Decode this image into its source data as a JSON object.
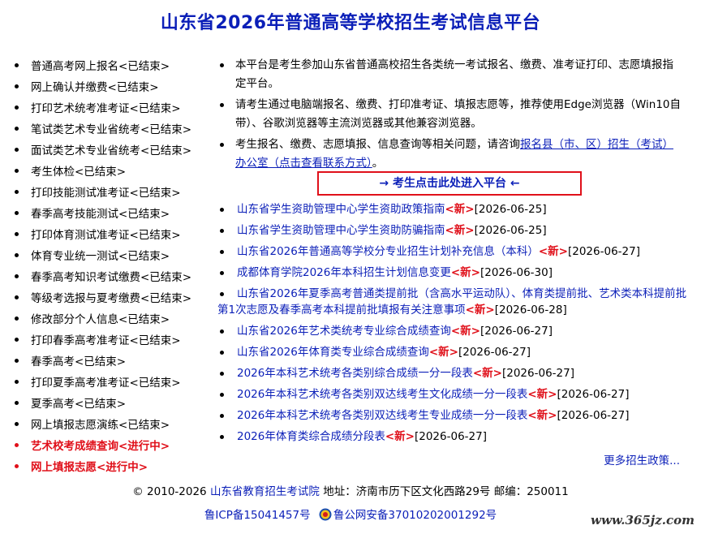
{
  "title": "山东省2026年普通高等学校招生考试信息平台",
  "left_menu": [
    {
      "label": "普通高考网上报名<已结束>",
      "active": false
    },
    {
      "label": "网上确认并缴费<已结束>",
      "active": false
    },
    {
      "label": "打印艺术统考准考证<已结束>",
      "active": false
    },
    {
      "label": "笔试类艺术专业省统考<已结束>",
      "active": false
    },
    {
      "label": "面试类艺术专业省统考<已结束>",
      "active": false
    },
    {
      "label": "考生体检<已结束>",
      "active": false
    },
    {
      "label": "打印技能测试准考证<已结束>",
      "active": false
    },
    {
      "label": "春季高考技能测试<已结束>",
      "active": false
    },
    {
      "label": "打印体育测试准考证<已结束>",
      "active": false
    },
    {
      "label": "体育专业统一测试<已结束>",
      "active": false
    },
    {
      "label": "春季高考知识考试缴费<已结束>",
      "active": false
    },
    {
      "label": "等级考选报与夏考缴费<已结束>",
      "active": false
    },
    {
      "label": "修改部分个人信息<已结束>",
      "active": false
    },
    {
      "label": "打印春季高考准考证<已结束>",
      "active": false
    },
    {
      "label": "春季高考<已结束>",
      "active": false
    },
    {
      "label": "打印夏季高考准考证<已结束>",
      "active": false
    },
    {
      "label": "夏季高考<已结束>",
      "active": false
    },
    {
      "label": "网上填报志愿演练<已结束>",
      "active": false
    },
    {
      "label": "艺术校考成绩查询<进行中>",
      "active": true
    },
    {
      "label": "网上填报志愿<进行中>",
      "active": true
    }
  ],
  "notes": {
    "n1": "本平台是考生参加山东省普通高校招生各类统一考试报名、缴费、准考证打印、志愿填报指定平台。",
    "n2": "请考生通过电脑端报名、缴费、打印准考证、填报志愿等，推荐使用Edge浏览器（Win10自带）、谷歌浏览器等主流浏览器或其他兼容浏览器。",
    "n3_prefix": "考生报名、缴费、志愿填报、信息查询等相关问题，请咨询",
    "n3_link": "报名县（市、区）招生（考试）办公室（点击查看联系方式）",
    "n3_suffix": "。"
  },
  "enter_button": "→ 考生点击此处进入平台 ←",
  "new_tag": "<新>",
  "news": [
    {
      "title": "山东省学生资助管理中心学生资助政策指南",
      "date": "[2026-06-25]"
    },
    {
      "title": "山东省学生资助管理中心学生资助防骗指南",
      "date": "[2026-06-25]"
    },
    {
      "title": "山东省2026年普通高等学校分专业招生计划补充信息（本科）",
      "date": "[2026-06-27]"
    },
    {
      "title": "成都体育学院2026年本科招生计划信息变更",
      "date": "[2026-06-30]"
    },
    {
      "title": "山东省2026年夏季高考普通类提前批（含高水平运动队）、体育类提前批、艺术类本科提前批第1次志愿及春季高考本科提前批填报有关注意事项",
      "date": "[2026-06-28]",
      "wrap": true
    },
    {
      "title": "山东省2026年艺术类统考专业综合成绩查询",
      "date": "[2026-06-27]"
    },
    {
      "title": "山东省2026年体育类专业综合成绩查询",
      "date": "[2026-06-27]"
    },
    {
      "title": "2026年本科艺术统考各类别综合成绩一分一段表",
      "date": "[2026-06-27]"
    },
    {
      "title": "2026年本科艺术统考各类别双达线考生文化成绩一分一段表",
      "date": "[2026-06-27]"
    },
    {
      "title": "2026年本科艺术统考各类别双达线考生专业成绩一分一段表",
      "date": "[2026-06-27]"
    },
    {
      "title": "2026年体育类综合成绩分段表",
      "date": "[2026-06-27]"
    }
  ],
  "more_link": "更多招生政策...",
  "footer": {
    "copyright": "© 2010-2026 ",
    "org": "山东省教育招生考试院",
    "address": " 地址：济南市历下区文化西路29号 邮编：250011",
    "icp": "鲁ICP备15041457号",
    "police": "鲁公网安备37010202001292号"
  },
  "watermark": "www.365jz.com",
  "colors": {
    "link": "#0b1fb8",
    "active": "#e0101a"
  }
}
